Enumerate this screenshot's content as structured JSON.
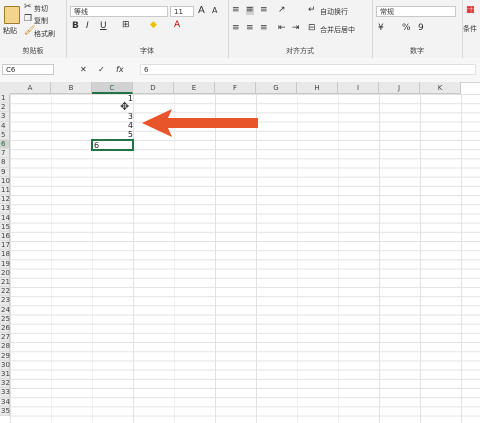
{
  "ribbon": {
    "clipboard": {
      "paste": "粘贴",
      "cut": "剪切",
      "copy": "复制",
      "format_painter": "格式刷",
      "label": "剪贴板"
    },
    "font": {
      "name": "等线",
      "size": "11",
      "label": "字体",
      "bold": "B",
      "italic": "I",
      "underline": "U",
      "grow": "A",
      "shrink": "A"
    },
    "alignment": {
      "wrap": "自动换行",
      "merge": "合并后居中",
      "label": "对齐方式"
    },
    "number": {
      "format": "常规",
      "percent": "%",
      "comma": "9",
      "label": "数字"
    },
    "styles": {
      "cond": "条件"
    }
  },
  "formula_bar": {
    "name_box": "C6",
    "cancel": "✕",
    "enter": "✓",
    "fx": "fx",
    "value": "6"
  },
  "columns": [
    "A",
    "B",
    "C",
    "D",
    "E",
    "F",
    "G",
    "H",
    "I",
    "J",
    "K"
  ],
  "rows": [
    "1",
    "2",
    "3",
    "4",
    "5",
    "6",
    "7",
    "8",
    "9",
    "10",
    "11",
    "12",
    "13",
    "14",
    "15",
    "16",
    "17",
    "18",
    "19",
    "20",
    "21",
    "22",
    "23",
    "24",
    "25",
    "26",
    "27",
    "28",
    "29",
    "30",
    "31",
    "32",
    "33",
    "34",
    "35"
  ],
  "cells": {
    "c1": "1",
    "c3": "3",
    "c4": "4",
    "c5": "5",
    "c6": "6"
  },
  "colors": {
    "accent": "#217346",
    "arrow": "#e8552a"
  }
}
